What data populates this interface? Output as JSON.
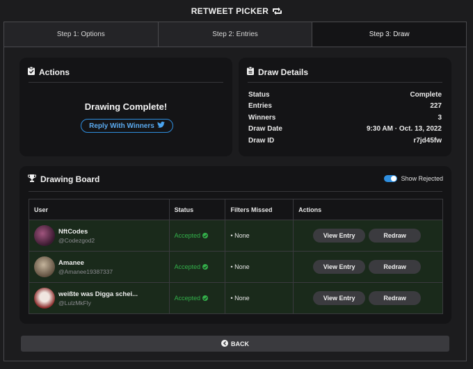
{
  "app": {
    "title": "RETWEET PICKER",
    "icon": "retweet-icon"
  },
  "steps": [
    {
      "label": "Step 1: Options",
      "active": false
    },
    {
      "label": "Step 2: Entries",
      "active": false
    },
    {
      "label": "Step 3: Draw",
      "active": true
    }
  ],
  "actions": {
    "title": "Actions",
    "icon": "clipboard-check-icon",
    "message": "Drawing Complete!",
    "reply_button": "Reply With Winners",
    "reply_icon": "twitter-icon"
  },
  "details": {
    "title": "Draw Details",
    "icon": "clipboard-icon",
    "rows": [
      {
        "label": "Status",
        "value": "Complete"
      },
      {
        "label": "Entries",
        "value": "227"
      },
      {
        "label": "Winners",
        "value": "3"
      },
      {
        "label": "Draw Date",
        "value": "9:30 AM · Oct. 13, 2022"
      },
      {
        "label": "Draw ID",
        "value": "r7jd45fw"
      }
    ]
  },
  "board": {
    "title": "Drawing Board",
    "icon": "trophy-icon",
    "toggle_label": "Show Rejected",
    "toggle_on": true,
    "columns": [
      "User",
      "Status",
      "Filters Missed",
      "Actions"
    ],
    "rows": [
      {
        "name": "NftCodes",
        "handle": "@Codezgod2",
        "status": "Accepted",
        "filters": "• None",
        "view": "View Entry",
        "redraw": "Redraw",
        "avatar_color": "#6b2a4e"
      },
      {
        "name": "Amanee",
        "handle": "@Amanee19387337",
        "status": "Accepted",
        "filters": "• None",
        "view": "View Entry",
        "redraw": "Redraw",
        "avatar_color": "#8a7a66"
      },
      {
        "name": "weißte was Digga schei...",
        "handle": "@LulzMkFly",
        "status": "Accepted",
        "filters": "• None",
        "view": "View Entry",
        "redraw": "Redraw",
        "avatar_color": "#7a3a3a"
      }
    ]
  },
  "back": {
    "label": "BACK",
    "icon": "arrow-left-circle-icon"
  },
  "colors": {
    "accent": "#2f8fe0",
    "success": "#33b04a",
    "row_bg": "#1a2a1b"
  }
}
